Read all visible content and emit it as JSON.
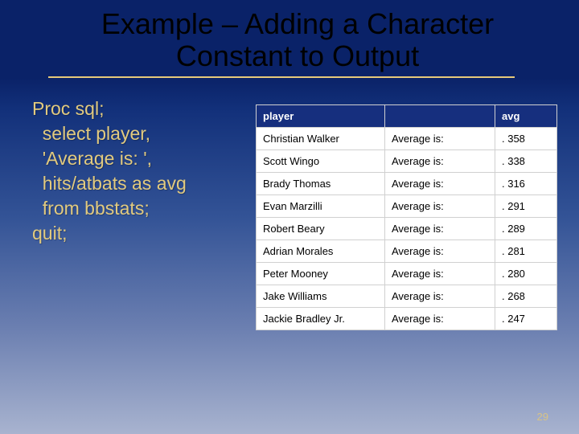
{
  "title": "Example – Adding a Character Constant to Output",
  "code_lines": [
    "Proc sql;",
    "  select player,",
    "  'Average is: ',",
    "  hits/atbats as avg",
    "  from bbstats;",
    "quit;"
  ],
  "table": {
    "headers": {
      "player": "player",
      "blank": "",
      "avg": "avg"
    },
    "label": "Average is:",
    "rows": [
      {
        "player": "Christian Walker",
        "avg": ". 358"
      },
      {
        "player": "Scott Wingo",
        "avg": ". 338"
      },
      {
        "player": "Brady Thomas",
        "avg": ". 316"
      },
      {
        "player": "Evan Marzilli",
        "avg": ". 291"
      },
      {
        "player": "Robert Beary",
        "avg": ". 289"
      },
      {
        "player": "Adrian Morales",
        "avg": ". 281"
      },
      {
        "player": "Peter Mooney",
        "avg": ". 280"
      },
      {
        "player": "Jake Williams",
        "avg": ". 268"
      },
      {
        "player": "Jackie Bradley Jr.",
        "avg": ". 247"
      }
    ]
  },
  "page_number": "29"
}
